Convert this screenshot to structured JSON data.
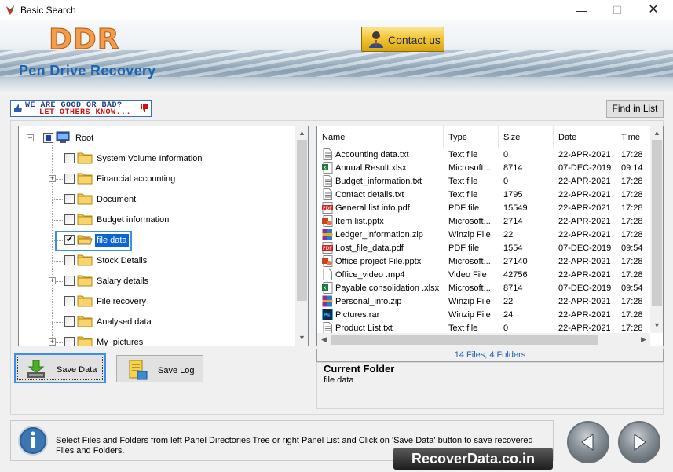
{
  "window": {
    "title": "Basic Search",
    "min": "—",
    "max": "☐",
    "close": "✕"
  },
  "banner": {
    "brand": "DDR",
    "product": "Pen Drive Recovery",
    "contact_label": "Contact us"
  },
  "rating": {
    "line1": "WE ARE GOOD OR BAD?",
    "line2": "LET OTHERS KNOW..."
  },
  "toolbar": {
    "find_label": "Find in List"
  },
  "tree": {
    "root": "Root",
    "items": [
      {
        "label": "System Volume Information",
        "expandable": false
      },
      {
        "label": "Financial accounting",
        "expandable": true
      },
      {
        "label": "Document",
        "expandable": false
      },
      {
        "label": "Budget information",
        "expandable": false
      },
      {
        "label": "file data",
        "expandable": false,
        "selected": true,
        "checked": true
      },
      {
        "label": "Stock Details",
        "expandable": false
      },
      {
        "label": "Salary details",
        "expandable": true
      },
      {
        "label": "File recovery",
        "expandable": false
      },
      {
        "label": "Analysed data",
        "expandable": false
      },
      {
        "label": "My_pictures",
        "expandable": true
      }
    ]
  },
  "list": {
    "columns": [
      "Name",
      "Type",
      "Size",
      "Date",
      "Time"
    ],
    "rows": [
      {
        "name": "Accounting data.txt",
        "type": "Text file",
        "size": "0",
        "date": "22-APR-2021",
        "time": "17:28",
        "icon": "text-file-icon"
      },
      {
        "name": "Annual Result.xlsx",
        "type": "Microsoft...",
        "size": "8714",
        "date": "07-DEC-2019",
        "time": "09:14",
        "icon": "excel-file-icon"
      },
      {
        "name": "Budget_information.txt",
        "type": "Text file",
        "size": "0",
        "date": "22-APR-2021",
        "time": "17:28",
        "icon": "text-file-icon"
      },
      {
        "name": "Contact details.txt",
        "type": "Text file",
        "size": "1795",
        "date": "22-APR-2021",
        "time": "17:28",
        "icon": "text-file-icon"
      },
      {
        "name": "General list info.pdf",
        "type": "PDF file",
        "size": "15549",
        "date": "22-APR-2021",
        "time": "17:28",
        "icon": "pdf-file-icon"
      },
      {
        "name": "Item list.pptx",
        "type": "Microsoft...",
        "size": "2714",
        "date": "22-APR-2021",
        "time": "17:28",
        "icon": "powerpoint-file-icon"
      },
      {
        "name": "Ledger_information.zip",
        "type": "Winzip File",
        "size": "22",
        "date": "22-APR-2021",
        "time": "17:28",
        "icon": "zip-file-icon"
      },
      {
        "name": "Lost_file_data.pdf",
        "type": "PDF file",
        "size": "1554",
        "date": "07-DEC-2019",
        "time": "09:54",
        "icon": "pdf-file-icon"
      },
      {
        "name": "Office project File.pptx",
        "type": "Microsoft...",
        "size": "27140",
        "date": "22-APR-2021",
        "time": "17:28",
        "icon": "powerpoint-file-icon"
      },
      {
        "name": "Office_video .mp4",
        "type": "Video File",
        "size": "42756",
        "date": "22-APR-2021",
        "time": "17:28",
        "icon": "blank-file-icon"
      },
      {
        "name": "Payable consolidation .xlsx",
        "type": "Microsoft...",
        "size": "8714",
        "date": "07-DEC-2019",
        "time": "09:54",
        "icon": "excel-file-icon"
      },
      {
        "name": "Personal_info.zip",
        "type": "Winzip File",
        "size": "22",
        "date": "22-APR-2021",
        "time": "17:28",
        "icon": "zip-file-icon"
      },
      {
        "name": "Pictures.rar",
        "type": "Winzip File",
        "size": "24",
        "date": "22-APR-2021",
        "time": "17:28",
        "icon": "photoshop-file-icon"
      },
      {
        "name": "Product List.txt",
        "type": "Text file",
        "size": "0",
        "date": "22-APR-2021",
        "time": "17:28",
        "icon": "text-file-icon"
      }
    ]
  },
  "status": {
    "summary": "14 Files, 4 Folders"
  },
  "current_folder": {
    "heading": "Current Folder",
    "value": "file data"
  },
  "buttons": {
    "save_data": "Save Data",
    "save_log": "Save Log"
  },
  "info": {
    "text": "Select Files and Folders from left Panel Directories Tree or right Panel List and Click on 'Save Data' button to save recovered Files and Folders."
  },
  "footer": {
    "site": "RecoverData.co.in"
  },
  "colors": {
    "accent": "#0a64d6",
    "brand": "#f39c4a",
    "product": "#1a66b5",
    "status_text": "#1f5fbf"
  }
}
